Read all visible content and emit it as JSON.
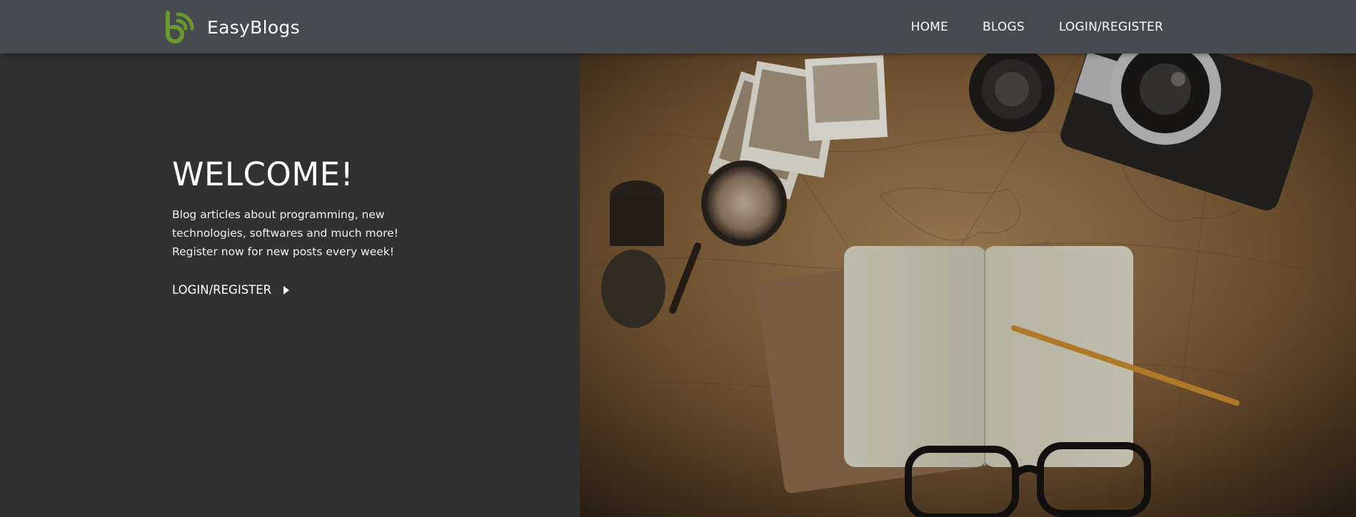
{
  "brand": {
    "name": "EasyBlogs",
    "logo_icon": "blog-b-logo-icon",
    "logo_color": "#6a9a2e"
  },
  "nav": {
    "items": [
      {
        "label": "HOME"
      },
      {
        "label": "BLOGS"
      },
      {
        "label": "LOGIN/REGISTER"
      }
    ]
  },
  "hero": {
    "title": "WELCOME!",
    "text_lines": [
      "Blog articles about programming, new",
      "technologies, softwares and much more!",
      "Register now for new posts every week!"
    ],
    "cta_label": "LOGIN/REGISTER",
    "cta_icon": "play-arrow-icon",
    "image_subject": "map-notebook-camera-photo"
  },
  "colors": {
    "navbar_bg": "#474a4f",
    "page_bg": "#313131",
    "accent": "#6a9a2e",
    "map_tone": "#8a6a40"
  }
}
